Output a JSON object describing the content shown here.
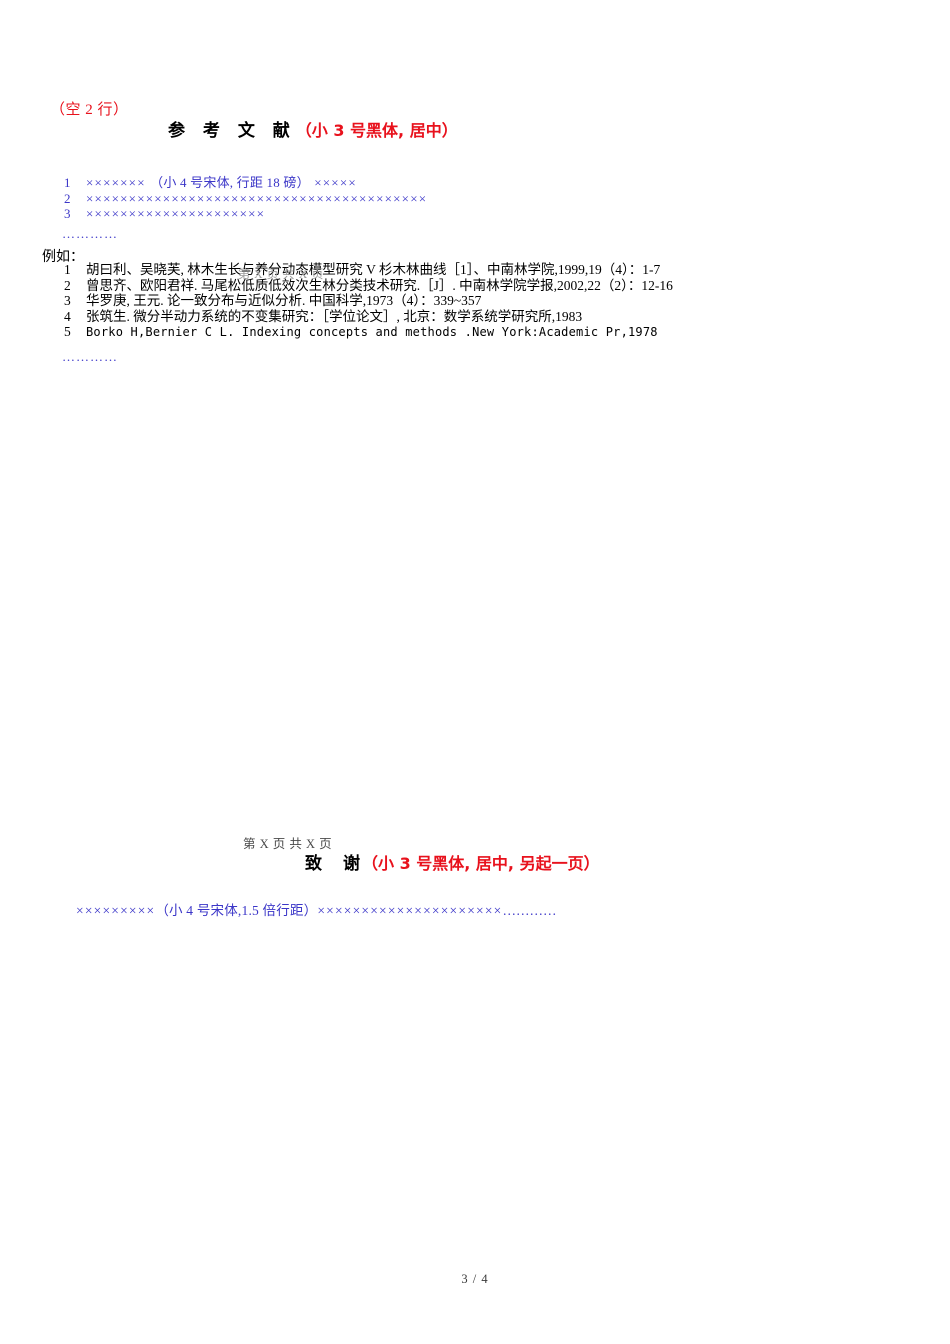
{
  "document": {
    "empty_lines_note": "（空 2 行）",
    "page_footer": "3 / 4",
    "page_marker": "第 X 页 共 X 页"
  },
  "references_section": {
    "heading_title": "参 考 文 献",
    "heading_annotation": "（小 3 号黑体, 居中）",
    "placeholders": [
      {
        "number": "1",
        "prefix_x": "××××××× ",
        "annotation": "（小 4 号宋体, 行距 18 磅）",
        "suffix_x": " ×××××"
      },
      {
        "number": "2",
        "prefix_x": "××××××××××××××××××××××××××××××××××××××××",
        "annotation": "",
        "suffix_x": ""
      },
      {
        "number": "3",
        "prefix_x": "×××××××××××××××××××××",
        "annotation": "",
        "suffix_x": ""
      }
    ],
    "placeholder_ellipsis": "…………",
    "example_label": "例如：",
    "examples": [
      {
        "number": "1",
        "text": "胡曰利、吴晓芙, 林木生长与养分动态模型研究 V 杉木林曲线［1］、中南林学院,1999,19（4）：1-7",
        "monospace": false
      },
      {
        "number": "2",
        "text": "曾思齐、欧阳君祥. 马尾松低质低效次生林分类技术研究.［J］. 中南林学院学报,2002,22（2）：12-16",
        "monospace": false
      },
      {
        "number": "3",
        "text": "华罗庚, 王元. 论一致分布与近似分析. 中国科学,1973（4）：339~357",
        "monospace": false
      },
      {
        "number": "4",
        "text": "张筑生. 微分半动力系统的不变集研究：［学位论文］, 北京：数学系统学研究所,1983",
        "monospace": false
      },
      {
        "number": "5",
        "text": "Borko H,Bernier C L. Indexing concepts and methods .New York:Academic Pr,1978",
        "monospace": true
      }
    ],
    "example_ellipsis": "…………"
  },
  "thanks_section": {
    "heading_title": "致　谢",
    "heading_annotation": "（小 3 号黑体, 居中, 另起一页）",
    "body_prefix_x": "×××××××××",
    "body_annotation": "（小 4 号宋体,1.5 倍行距）",
    "body_suffix_x": "×××××××××××××××××××××",
    "body_ellipsis": "…………"
  },
  "colors": {
    "annotation_red": "#e8111c",
    "placeholder_blue": "#3b36c8",
    "body_black": "#000000"
  }
}
